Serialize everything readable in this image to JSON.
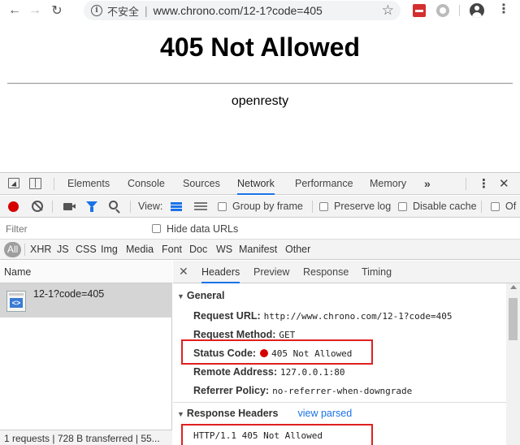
{
  "browser": {
    "insecure_label": "不安全",
    "url": "www.chrono.com/12-1?code=405"
  },
  "page": {
    "heading": "405 Not Allowed",
    "server": "openresty"
  },
  "devtools": {
    "tabs": [
      "Elements",
      "Console",
      "Sources",
      "Network",
      "Performance",
      "Memory"
    ],
    "active_tab": "Network",
    "more": "»",
    "toolbar": {
      "view_label": "View:",
      "group_by_frame": "Group by frame",
      "preserve_log": "Preserve log",
      "disable_cache": "Disable cache",
      "offline": "Of"
    },
    "filter_placeholder": "Filter",
    "hide_data_urls": "Hide data URLs",
    "types": [
      "All",
      "XHR",
      "JS",
      "CSS",
      "Img",
      "Media",
      "Font",
      "Doc",
      "WS",
      "Manifest",
      "Other"
    ],
    "name_header": "Name",
    "request_name": "12-1?code=405",
    "summary": "1 requests | 728 B transferred | 55...",
    "detail_tabs": [
      "Headers",
      "Preview",
      "Response",
      "Timing"
    ],
    "active_detail_tab": "Headers",
    "general": {
      "title": "General",
      "rows": [
        {
          "key": "Request URL:",
          "value": "http://www.chrono.com/12-1?code=405"
        },
        {
          "key": "Request Method:",
          "value": "GET"
        },
        {
          "key": "Status Code:",
          "value": "405 Not Allowed"
        },
        {
          "key": "Remote Address:",
          "value": "127.0.0.1:80"
        },
        {
          "key": "Referrer Policy:",
          "value": "no-referrer-when-downgrade"
        }
      ]
    },
    "response_headers": {
      "title": "Response Headers",
      "view_parsed": "view parsed",
      "first_line": "HTTP/1.1 405 Not Allowed"
    }
  },
  "colors": {
    "accent": "#1a73e8",
    "highlight": "#e02020",
    "status_error": "#d50000"
  }
}
